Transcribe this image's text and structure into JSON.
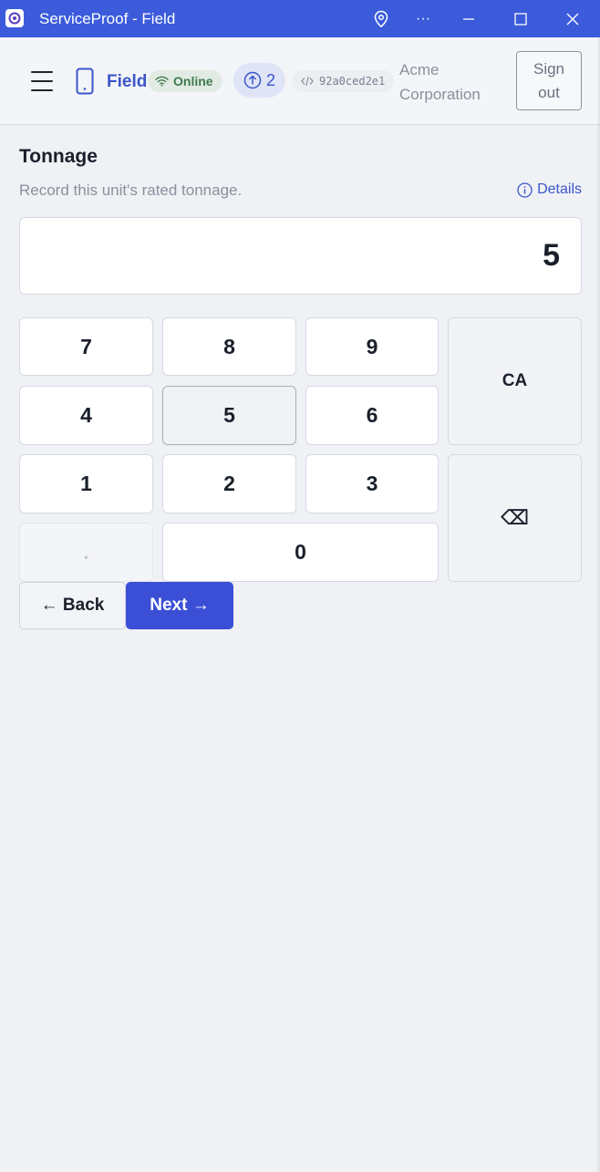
{
  "window": {
    "title": "ServiceProof - Field",
    "controls": {
      "location_icon": "location-pin-icon",
      "more": "···",
      "minimize_icon": "minimize-icon",
      "maximize_icon": "maximize-icon",
      "close_icon": "close-icon"
    },
    "accent_color": "#3b5bdb"
  },
  "header": {
    "menu_icon": "hamburger-menu-icon",
    "device_icon": "mobile-phone-icon",
    "brand": "Field",
    "status": {
      "label": "Online",
      "icon": "wifi-icon",
      "color": "#3f7a4e"
    },
    "sync": {
      "count": "2",
      "icon": "upload-arrow-circle-icon"
    },
    "commit": {
      "hash": "92a0ced2e1",
      "icon": "code-icon"
    },
    "org_line1": "Acme",
    "org_line2": "Corporation",
    "signout_line1": "Sign",
    "signout_line2": "out"
  },
  "field": {
    "title": "Tonnage",
    "help": "Record this unit's rated tonnage.",
    "details_label": "Details",
    "value": "5"
  },
  "keypad": {
    "k7": "7",
    "k8": "8",
    "k9": "9",
    "k4": "4",
    "k5": "5",
    "k6": "6",
    "k1": "1",
    "k2": "2",
    "k3": "3",
    "decimal": ".",
    "k0": "0",
    "clear": "CA",
    "backspace": "⌫"
  },
  "nav": {
    "back": "← Back",
    "next": "Next →",
    "next_color": "#3b4fd6"
  }
}
